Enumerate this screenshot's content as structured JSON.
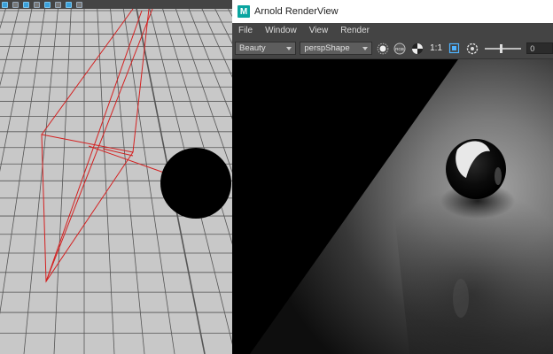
{
  "viewport": {
    "toolbar_icons": [
      "cube-icon",
      "cube-icon",
      "sphere-icon",
      "sphere-icon",
      "checker-icon",
      "light-icon",
      "camera-icon",
      "render-icon"
    ]
  },
  "render_view": {
    "window_title": "Arnold RenderView",
    "logo_letter": "M",
    "menu": [
      "File",
      "Window",
      "View",
      "Render"
    ],
    "aov_selected": "Beauty",
    "camera_selected": "perspShape",
    "ratio_label": "1:1",
    "exposure_value": "0",
    "colors": {
      "logo": "#0aa5a0",
      "titlebar": "#ffffff",
      "panel": "#444444",
      "viewport_grid_bg": "#c8c8c8",
      "camera_frustum": "#d42020"
    }
  }
}
